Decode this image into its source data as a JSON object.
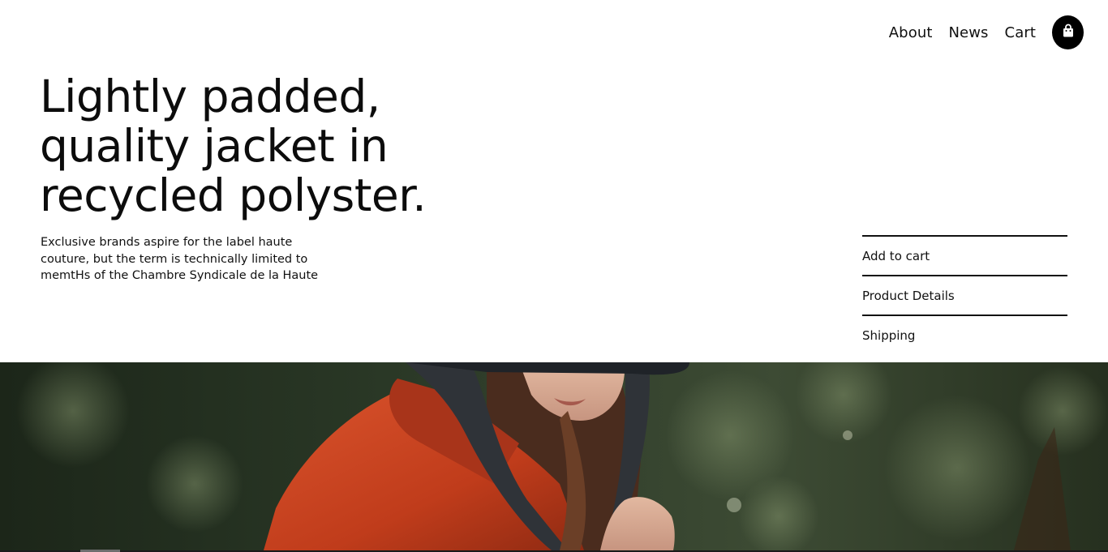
{
  "nav": {
    "links": [
      "About",
      "News",
      "Cart"
    ],
    "bag_icon": "shopping-bag-icon"
  },
  "hero": {
    "headline": "Lightly padded, quality jacket in recycled polyster.",
    "description": "Exclusive brands aspire for the label haute couture, but the term is technically limited to memtHs of the Chambre Syndicale de la Haute"
  },
  "actions": [
    "Add to cart",
    "Product Details",
    "Shipping"
  ],
  "colors": {
    "text": "#0c0c0c",
    "accent": "#000000",
    "jacket": "#c8401f",
    "foliage": "#2c3a27"
  }
}
